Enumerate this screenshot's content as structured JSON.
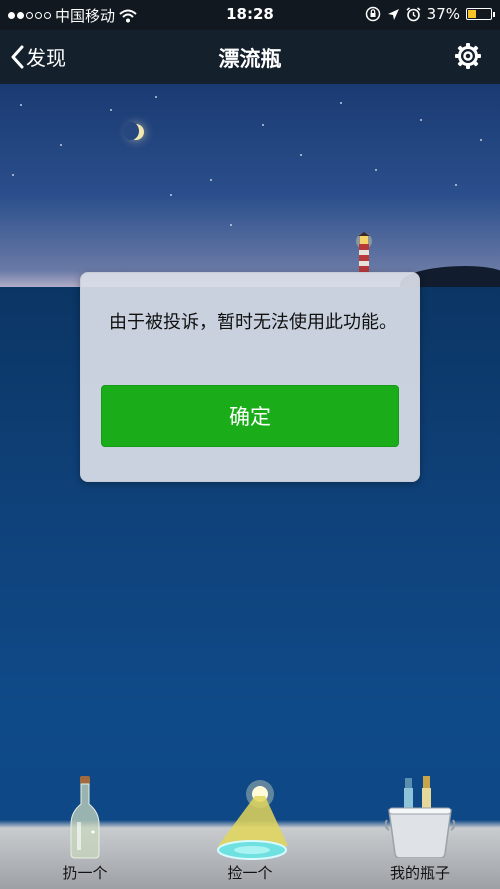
{
  "status_bar": {
    "carrier": "中国移动",
    "time": "18:28",
    "battery": "37%",
    "battery_level": 0.37
  },
  "nav": {
    "back_label": "发现",
    "title": "漂流瓶"
  },
  "dialog": {
    "message": "由于被投诉，暂时无法使用此功能。",
    "confirm_label": "确定"
  },
  "bottom_actions": {
    "throw_label": "扔一个",
    "pick_label": "捡一个",
    "mine_label": "我的瓶子"
  },
  "colors": {
    "primary_button": "#1aad19",
    "battery_fill": "#f6c42a"
  },
  "icons": [
    "back-chevron-icon",
    "gear-icon",
    "wifi-icon",
    "location-arrow-icon",
    "alarm-icon",
    "lock-rotation-icon",
    "bottle-icon",
    "spotlight-icon",
    "ice-bucket-icon"
  ]
}
